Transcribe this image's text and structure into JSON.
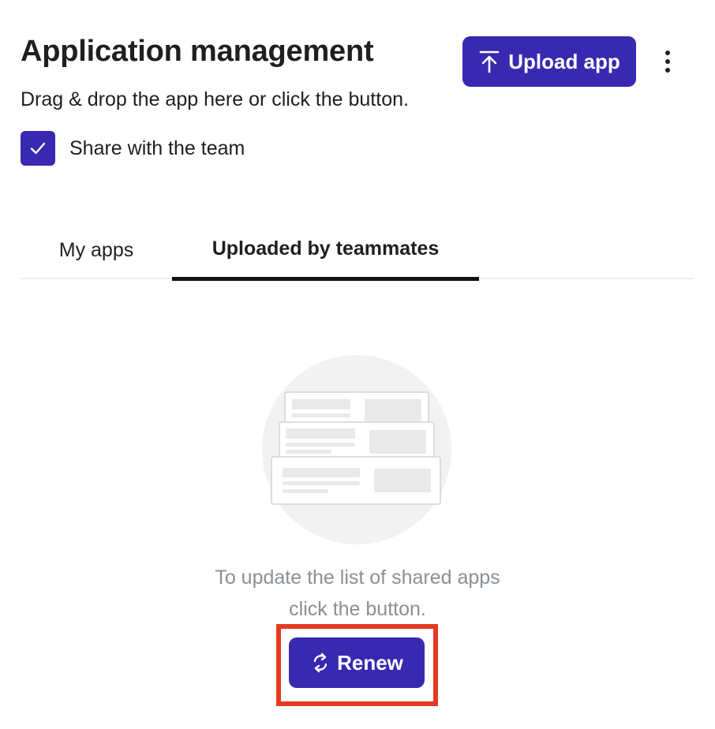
{
  "header": {
    "title": "Application management",
    "subtitle": "Drag & drop the app here or click the button.",
    "upload_button_label": "Upload app",
    "upload_icon": "upload-icon",
    "more_icon": "more-vertical-icon"
  },
  "share": {
    "label": "Share with the team",
    "checked": true
  },
  "tabs": [
    {
      "label": "My apps",
      "active": false
    },
    {
      "label": "Uploaded by teammates",
      "active": true
    }
  ],
  "empty_state": {
    "illustration": "app-list-illustration",
    "line1": "To update the list of shared apps",
    "line2": "click the button.",
    "renew_button_label": "Renew",
    "renew_icon": "refresh-icon"
  },
  "colors": {
    "accent": "#3829b0",
    "highlight": "#e23b22",
    "muted_text": "#8a8f94"
  }
}
